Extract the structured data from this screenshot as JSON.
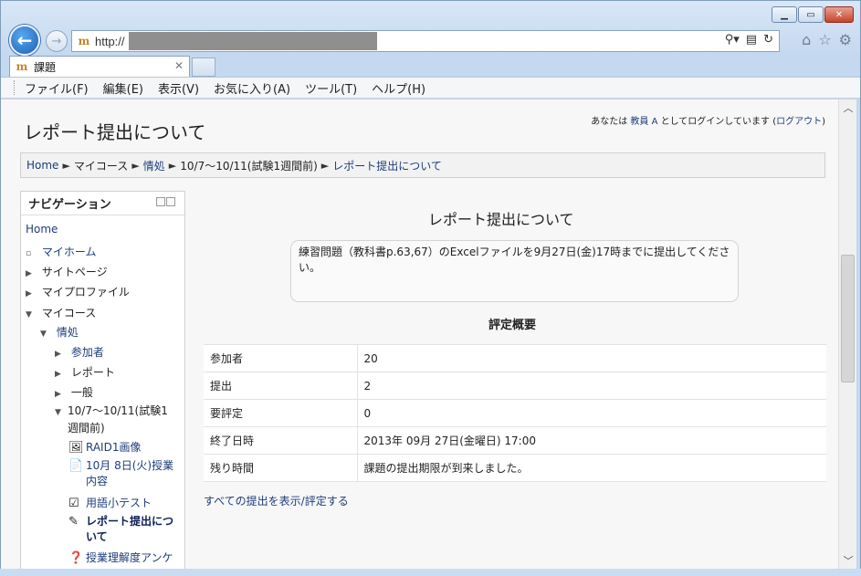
{
  "browser": {
    "address_prefix": "http://",
    "tab_title": "課題",
    "tab_favicon_glyph": "m",
    "menu": [
      "ファイル(F)",
      "編集(E)",
      "表示(V)",
      "お気に入り(A)",
      "ツール(T)",
      "ヘルプ(H)"
    ]
  },
  "page": {
    "heading": "レポート提出について",
    "login": {
      "prefix": "あなたは",
      "user": "教員 A",
      "middle": "としてログインしています (",
      "logout": "ログアウト",
      "suffix": ")"
    },
    "breadcrumb": [
      {
        "label": "Home",
        "link": true
      },
      {
        "label": "マイコース",
        "link": false
      },
      {
        "label": "情処",
        "link": true
      },
      {
        "label": "10/7～10/11(試験1週間前)",
        "link": false
      },
      {
        "label": "レポート提出について",
        "link": true
      }
    ],
    "breadcrumb_separator": "►"
  },
  "navigation": {
    "title": "ナビゲーション",
    "home": "Home",
    "items": [
      {
        "label": "マイホーム",
        "marker": "▫",
        "link": true
      },
      {
        "label": "サイトページ",
        "marker": "▶",
        "link": false
      },
      {
        "label": "マイプロファイル",
        "marker": "▶",
        "link": false
      },
      {
        "label": "マイコース",
        "marker": "▼",
        "link": false
      },
      {
        "label": "情処",
        "marker": "▼",
        "link": true
      },
      {
        "label": "参加者",
        "marker": "▶",
        "link": true
      },
      {
        "label": "レポート",
        "marker": "▶",
        "link": false
      },
      {
        "label": "一般",
        "marker": "▶",
        "link": false
      },
      {
        "label_line1": "10/7～10/11(試験1",
        "label_line2": "週間前)",
        "marker": "▼",
        "link": false
      },
      {
        "label": "RAID1画像",
        "icon": "image-icon",
        "link": true
      },
      {
        "label_line1": "10月 8日(火)授業",
        "label_line2": "内容",
        "icon": "page-icon",
        "link": true
      },
      {
        "label": "用語小テスト",
        "icon": "quiz-icon",
        "link": true
      },
      {
        "label_line1": "レポート提出につ",
        "label_line2": "いて",
        "icon": "assignment-icon",
        "link": true,
        "current": true
      },
      {
        "label": "授業理解度アンケ",
        "icon": "feedback-icon",
        "link": true
      }
    ]
  },
  "assignment": {
    "title": "レポート提出について",
    "intro": "練習問題（教科書p.63,67）のExcelファイルを9月27日(金)17時までに提出してください。",
    "summary_heading": "評定概要",
    "summary": [
      {
        "label": "参加者",
        "value": "20"
      },
      {
        "label": "提出",
        "value": "2"
      },
      {
        "label": "要評定",
        "value": "0"
      },
      {
        "label": "終了日時",
        "value": "2013年 09月 27日(金曜日) 17:00"
      },
      {
        "label": "残り時間",
        "value": "課題の提出期限が到来しました。"
      }
    ],
    "view_all_link": "すべての提出を表示/評定する"
  }
}
